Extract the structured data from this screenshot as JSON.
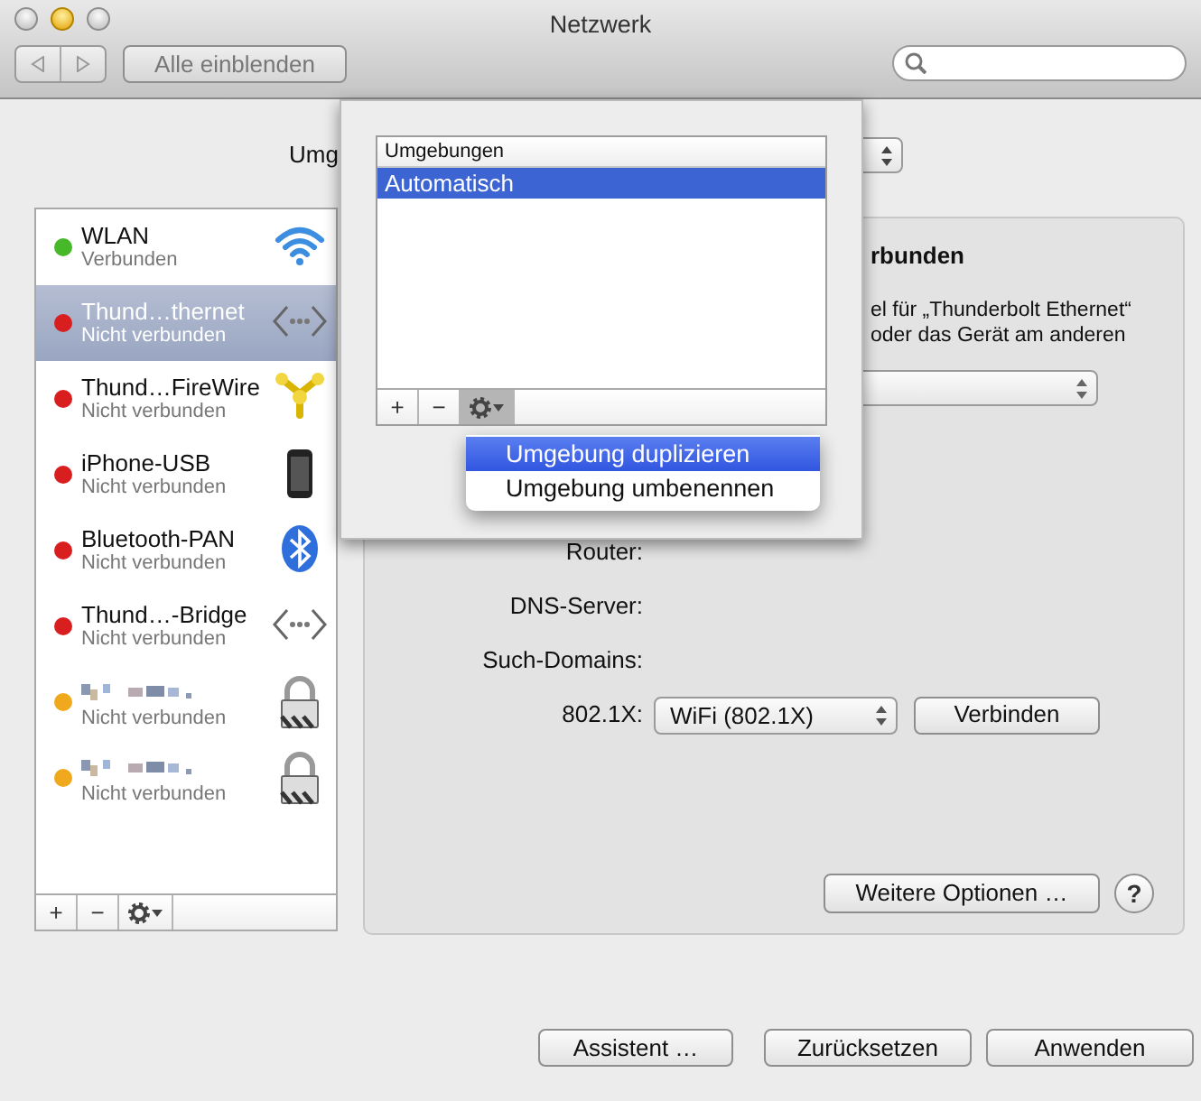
{
  "window": {
    "title": "Netzwerk"
  },
  "toolbar": {
    "show_all_button": "Alle einblenden"
  },
  "location": {
    "label": "Umg"
  },
  "services": [
    {
      "name": "WLAN",
      "status": "Verbunden",
      "color": "#46b82a",
      "selected": false,
      "kind": "wifi",
      "redacted": false
    },
    {
      "name": "Thund…thernet",
      "status": "Nicht verbunden",
      "color": "#d81e1e",
      "selected": true,
      "kind": "ethernet",
      "redacted": false
    },
    {
      "name": "Thund…FireWire",
      "status": "Nicht verbunden",
      "color": "#d81e1e",
      "selected": false,
      "kind": "firewire",
      "redacted": false
    },
    {
      "name": "iPhone-USB",
      "status": "Nicht verbunden",
      "color": "#d81e1e",
      "selected": false,
      "kind": "phone",
      "redacted": false
    },
    {
      "name": "Bluetooth-PAN",
      "status": "Nicht verbunden",
      "color": "#d81e1e",
      "selected": false,
      "kind": "bluetooth",
      "redacted": false
    },
    {
      "name": "Thund…-Bridge",
      "status": "Nicht verbunden",
      "color": "#d81e1e",
      "selected": false,
      "kind": "ethernet",
      "redacted": false
    },
    {
      "status": "Nicht verbunden",
      "color": "#f0a81c",
      "selected": false,
      "kind": "lock",
      "redacted": true
    },
    {
      "status": "Nicht verbunden",
      "color": "#f0a81c",
      "selected": false,
      "kind": "lock",
      "redacted": true
    }
  ],
  "list_toolbar": {
    "buttons": [
      "+",
      "−"
    ]
  },
  "detail": {
    "heading": "rbunden",
    "description_lines": [
      "el für „Thunderbolt Ethernet“",
      "oder das Gerät am anderen"
    ],
    "fields": [
      {
        "label": "Router:"
      },
      {
        "label": "DNS-Server:"
      },
      {
        "label": "Such-Domains:"
      },
      {
        "label": "802.1X:",
        "select": "WiFi (802.1X)",
        "button": "Verbinden"
      }
    ],
    "more_button": "Weitere Optionen …",
    "help": "?"
  },
  "footer_buttons": [
    "Assistent …",
    "Zurücksetzen",
    "Anwenden"
  ],
  "locations_popover": {
    "header": "Umgebungen",
    "items": [
      {
        "name": "Automatisch",
        "selected": true
      }
    ],
    "toolbar": [
      "+",
      "−"
    ],
    "gear_pressed": true,
    "menu": [
      {
        "label": "Umgebung duplizieren",
        "selected": true
      },
      {
        "label": "Umgebung umbenennen",
        "selected": false
      }
    ]
  }
}
